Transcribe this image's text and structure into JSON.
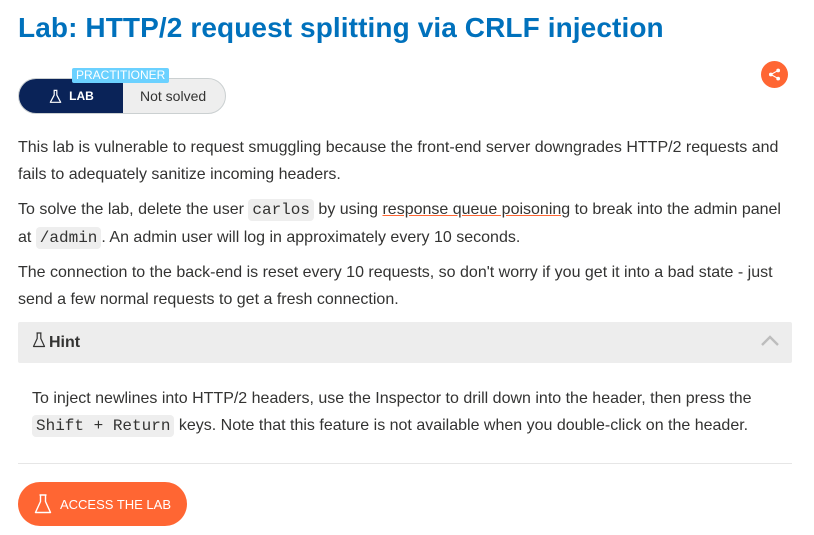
{
  "page": {
    "title": "Lab: HTTP/2 request splitting via CRLF injection"
  },
  "lab_widget": {
    "level": "PRACTITIONER",
    "lab_label": "LAB",
    "status": "Not solved"
  },
  "share": {
    "icon": "share-icon",
    "color": "#ff6633"
  },
  "description": {
    "p1": "This lab is vulnerable to request smuggling because the front-end server downgrades HTTP/2 requests and fails to adequately sanitize incoming headers.",
    "p2_a": "To solve the lab, delete the user ",
    "p2_code_user": "carlos",
    "p2_b": " by using ",
    "p2_link": "response queue poisoning",
    "p2_c": " to break into the admin panel at ",
    "p2_code_path": "/admin",
    "p2_d": ". An admin user will log in approximately every 10 seconds.",
    "p3": "The connection to the back-end is reset every 10 requests, so don't worry if you get it into a bad state - just send a few normal requests to get a fresh connection."
  },
  "hint": {
    "title": "Hint",
    "icon": "flask-icon",
    "toggle_icon": "chevron-up-icon",
    "body_a": "To inject newlines into HTTP/2 headers, use the Inspector to drill down into the header, then press the ",
    "body_code": "Shift + Return",
    "body_b": " keys. Note that this feature is not available when you double-click on the header."
  },
  "access_button": {
    "label": "ACCESS THE LAB",
    "icon": "flask-icon"
  },
  "colors": {
    "title": "#0071bc",
    "accent": "#ff6633",
    "lab_pill": "#0a2358",
    "level_badge": "#6bd1ff"
  }
}
